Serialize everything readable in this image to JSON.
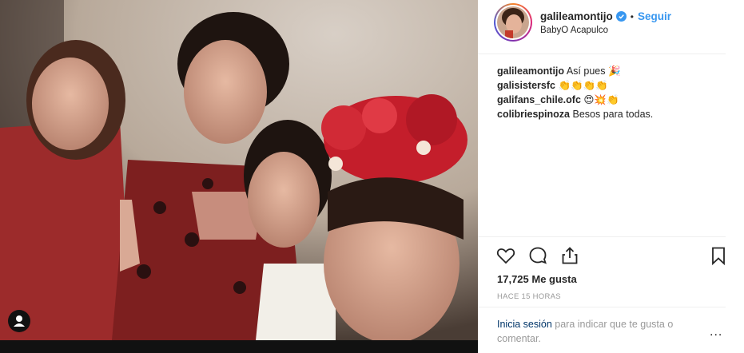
{
  "header": {
    "username": "galileamontijo",
    "separator": "•",
    "follow_label": "Seguir",
    "location": "BabyO Acapulco"
  },
  "comments": [
    {
      "user": "galileamontijo",
      "text": "Así pues 🎉"
    },
    {
      "user": "galisistersfc",
      "text": "👏👏👏👏"
    },
    {
      "user": "galifans_chile.ofc",
      "text": "😍💥👏"
    },
    {
      "user": "colibriespinoza",
      "text": "Besos para todas."
    }
  ],
  "stats": {
    "likes": "17,725 Me gusta",
    "time": "HACE 15 HORAS"
  },
  "login": {
    "link": "Inicia sesión",
    "text": " para indicar que te gusta o comentar.",
    "more": "..."
  },
  "colors": {
    "accent": "#3897f0",
    "link_dark": "#003569",
    "muted": "#999999"
  },
  "icons": [
    "verified-badge-icon",
    "heart-icon",
    "comment-icon",
    "share-icon",
    "bookmark-icon",
    "more-icon",
    "user-tag-icon"
  ]
}
